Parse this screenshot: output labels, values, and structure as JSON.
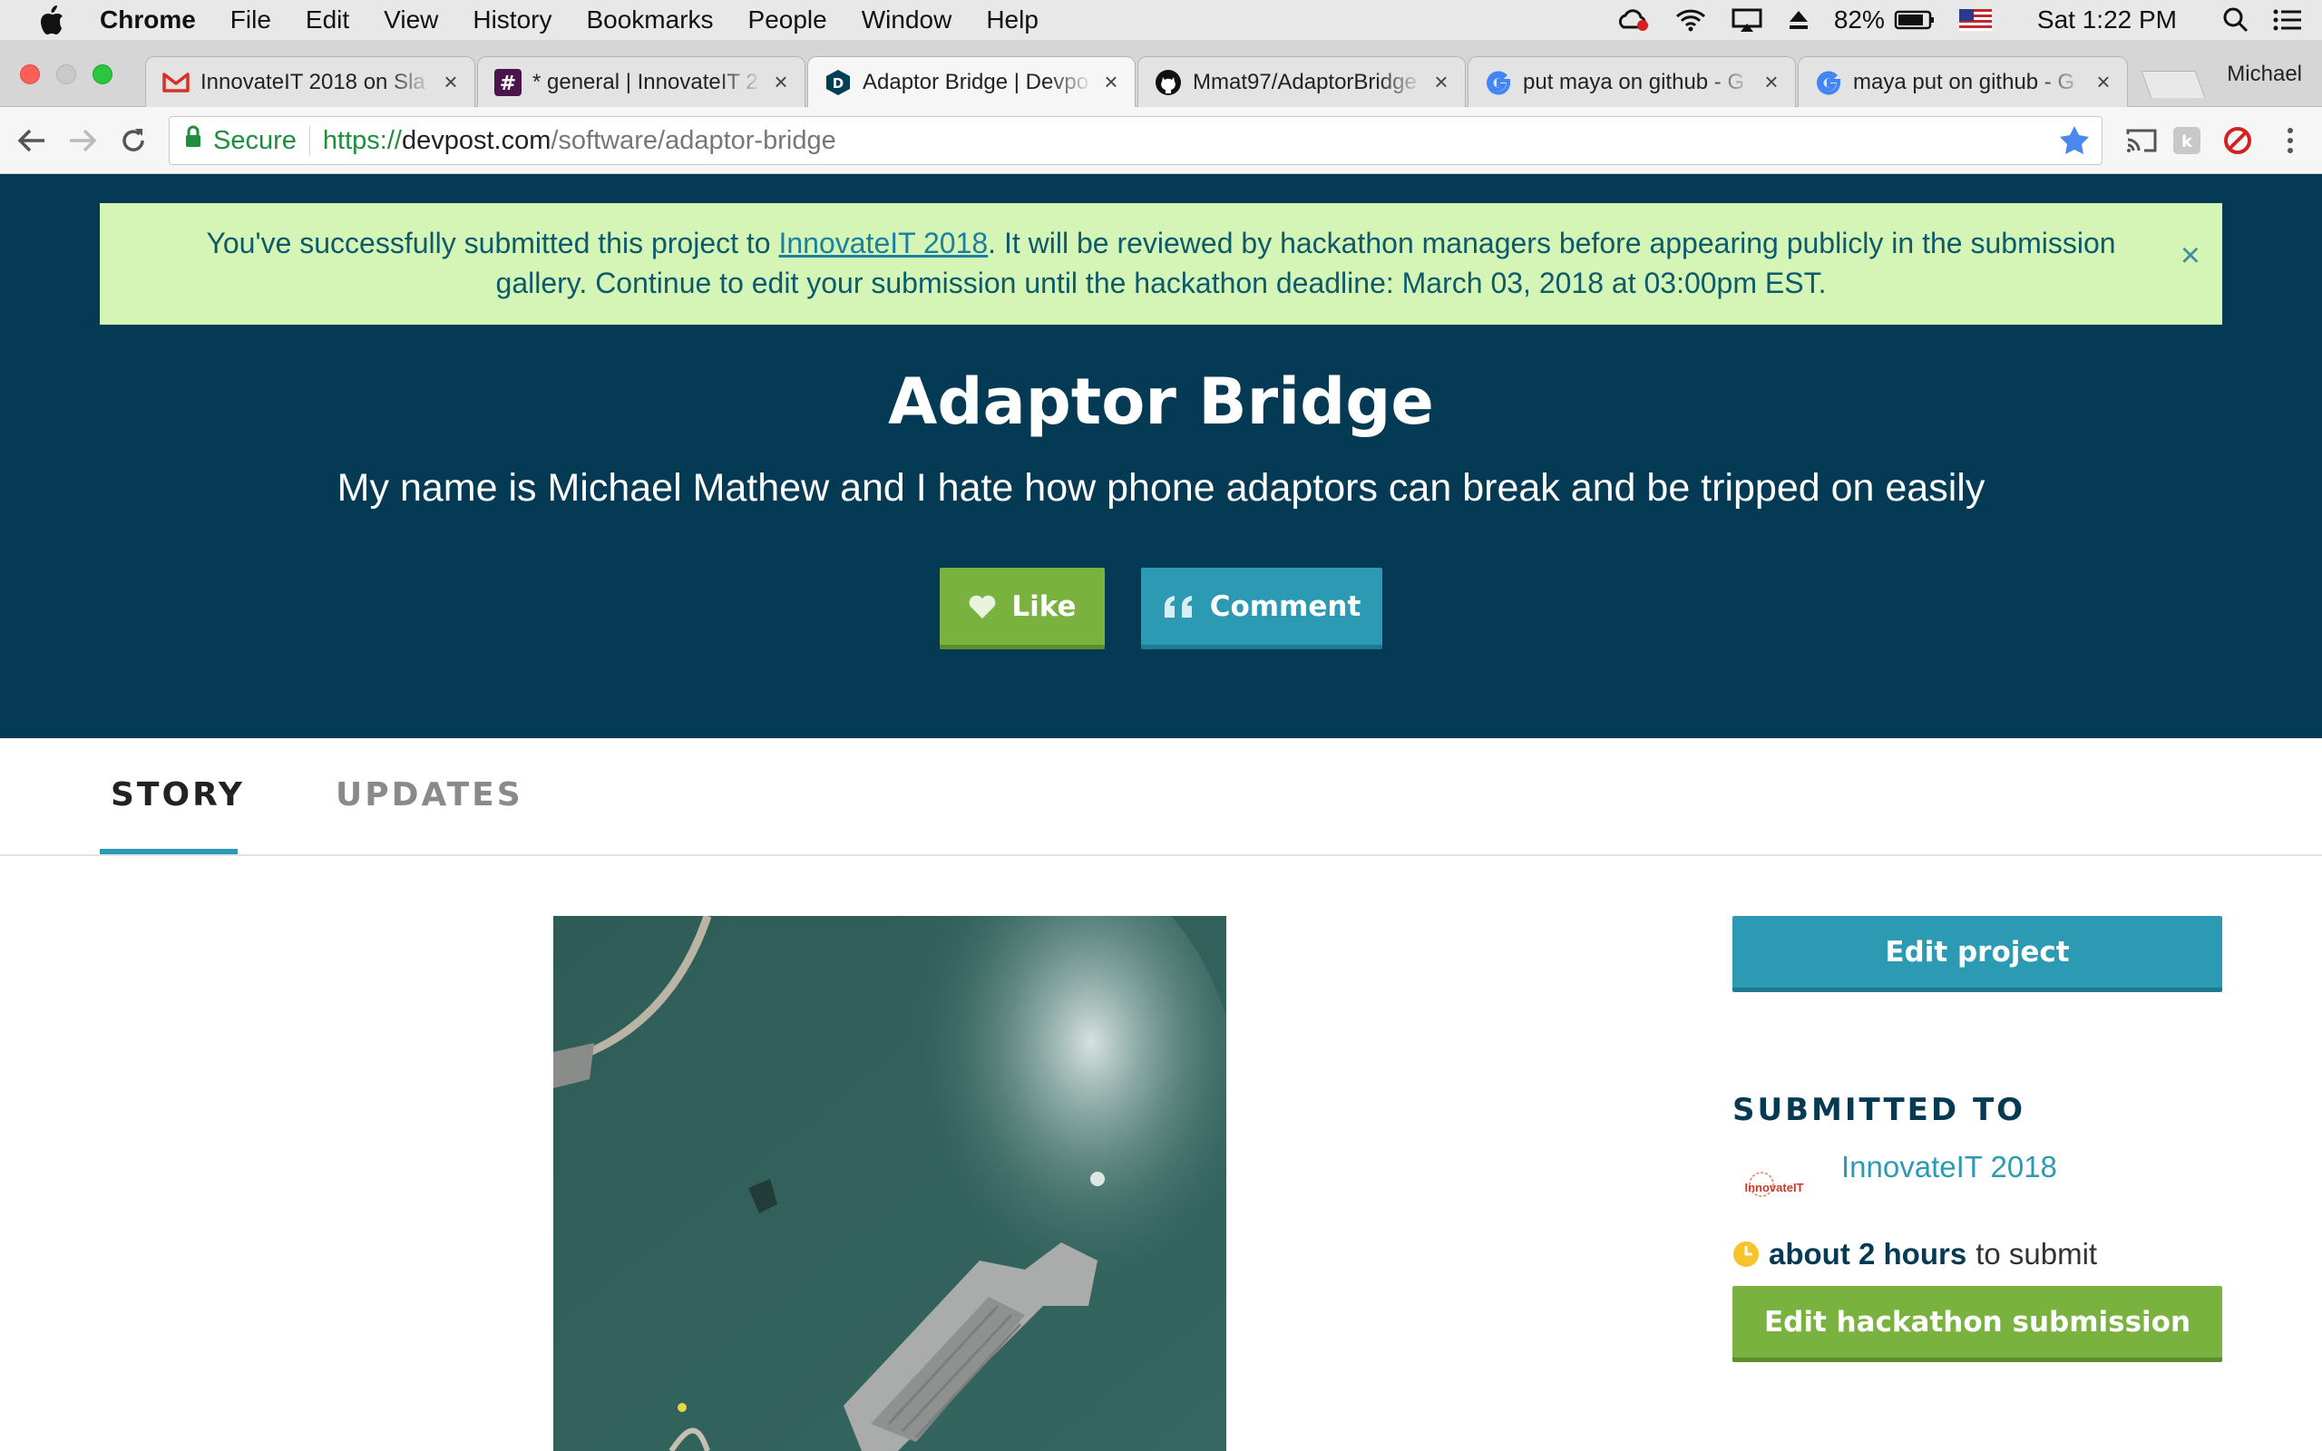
{
  "menubar": {
    "app": "Chrome",
    "items": [
      "File",
      "Edit",
      "View",
      "History",
      "Bookmarks",
      "People",
      "Window",
      "Help"
    ],
    "battery": "82%",
    "clock": "Sat 1:22 PM"
  },
  "tabs": [
    {
      "title": "InnovateIT 2018 on Sla",
      "icon": "gmail-icon"
    },
    {
      "title": "* general | InnovateIT 2",
      "icon": "slack-icon"
    },
    {
      "title": "Adaptor Bridge | Devpo",
      "icon": "devpost-icon",
      "active": true
    },
    {
      "title": "Mmat97/AdaptorBridge",
      "icon": "github-icon"
    },
    {
      "title": "put maya on github - G",
      "icon": "google-icon"
    },
    {
      "title": "maya put on github - G",
      "icon": "google-icon"
    }
  ],
  "profile_name": "Michael",
  "omnibox": {
    "secure_label": "Secure",
    "scheme": "https://",
    "host": "devpost.com",
    "path": "/software/adaptor-bridge"
  },
  "alert": {
    "prefix": "You've successfully submitted this project to ",
    "link": "InnovateIT 2018",
    "suffix": ". It will be reviewed by hackathon managers before appearing publicly in the submission",
    "line2": "gallery. Continue to edit your submission until the hackathon deadline: March 03, 2018 at 03:00pm EST."
  },
  "project": {
    "title": "Adaptor Bridge",
    "tagline": "My name is Michael Mathew and I hate how phone adaptors can break and be tripped on easily",
    "like_label": "Like",
    "comment_label": "Comment"
  },
  "subnav": {
    "story": "STORY",
    "updates": "UPDATES"
  },
  "sidebar": {
    "edit_project": "Edit project",
    "submitted_to": "SUBMITTED TO",
    "hackathon_name": "InnovateIT 2018",
    "logo_text": "InnovateIT",
    "deadline_bold": "about 2 hours",
    "deadline_rest": "to submit",
    "edit_submission": "Edit hackathon submission"
  },
  "colors": {
    "hero_bg": "#053a54",
    "alert_bg": "#d5f5b7",
    "teal": "#2d9ab4",
    "green": "#7ab240"
  }
}
